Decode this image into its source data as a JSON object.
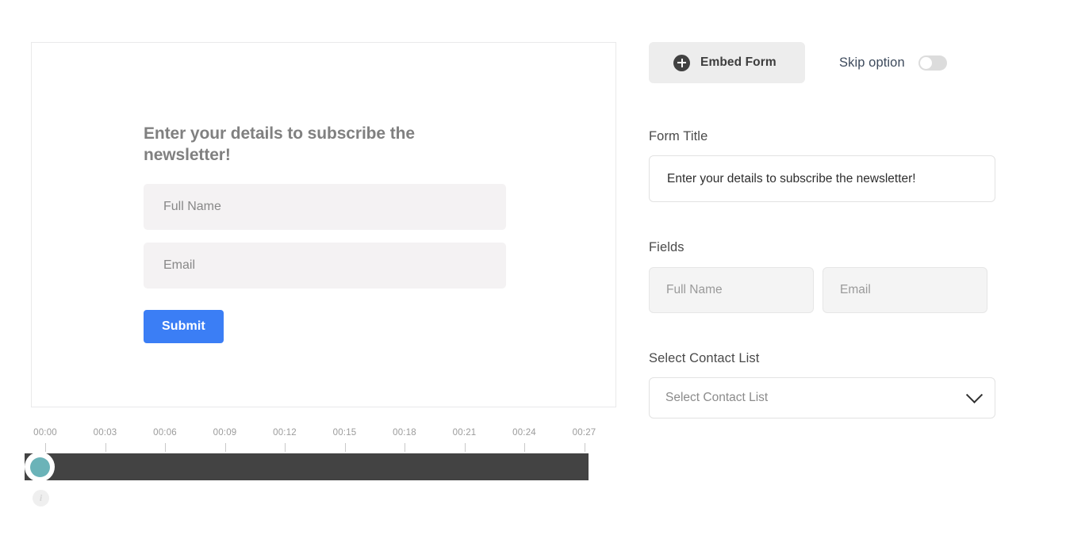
{
  "preview": {
    "heading": "Enter your details to subscribe the newsletter!",
    "fields": [
      {
        "placeholder": "Full Name"
      },
      {
        "placeholder": "Email"
      }
    ],
    "submit_label": "Submit"
  },
  "timeline": {
    "ticks": [
      "00:00",
      "00:03",
      "00:06",
      "00:09",
      "00:12",
      "00:15",
      "00:18",
      "00:21",
      "00:24",
      "00:27"
    ],
    "playhead_position": "00:00",
    "info_icon": "info-icon",
    "track_color": "#434343",
    "playhead_color": "#6bb3b8"
  },
  "panel": {
    "toolbar": {
      "embed_form_label": "Embed Form",
      "plus_icon": "plus-circle-icon",
      "skip_label": "Skip option",
      "skip_toggle_state": "off"
    },
    "form_title": {
      "label": "Form Title",
      "value": "Enter your details to subscribe the newsletter!",
      "placeholder": "Form Title"
    },
    "fields": {
      "label": "Fields",
      "items": [
        {
          "label": "Full Name"
        },
        {
          "label": "Email"
        }
      ]
    },
    "contact_list": {
      "label": "Select Contact List",
      "value": "Select Contact List",
      "chevron_icon": "chevron-down-icon"
    }
  },
  "colors": {
    "submit_blue": "#3b7ef5",
    "teal_playhead": "#6bb3b8",
    "track_dark": "#434343"
  }
}
